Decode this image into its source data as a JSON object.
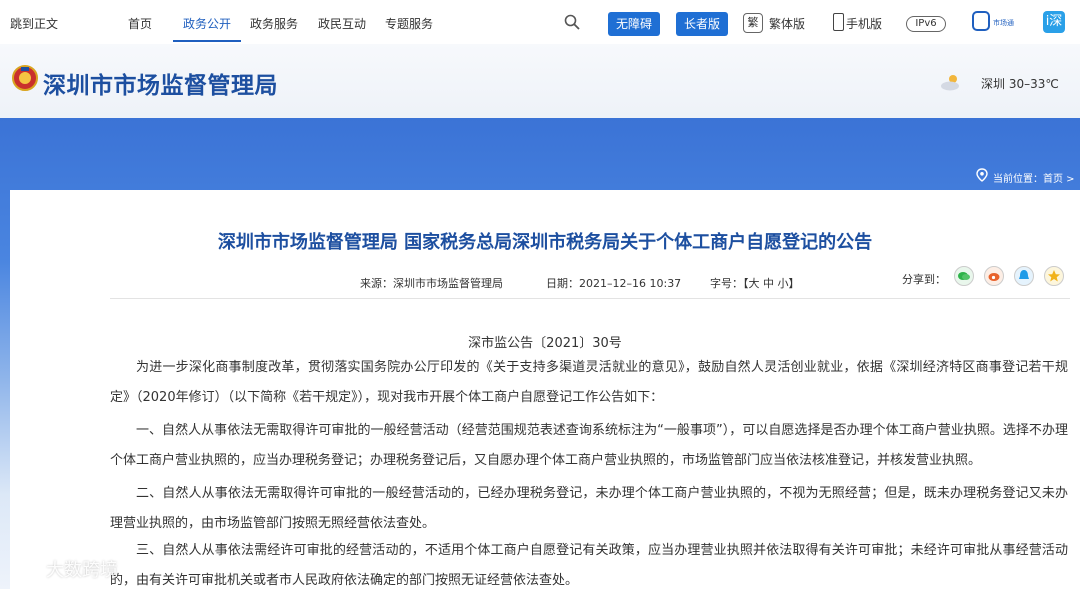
{
  "topnav": {
    "skip": "跳到正文",
    "items": [
      {
        "label": "首页"
      },
      {
        "label": "政务公开"
      },
      {
        "label": "政务服务"
      },
      {
        "label": "政民互动"
      },
      {
        "label": "专题服务"
      }
    ],
    "accessible_btn": "无障碍",
    "elder_btn": "长者版",
    "trad_char": "繁",
    "traditional": "繁体版",
    "mobile": "手机版",
    "ipv6": "IPv6",
    "shichang_label": "市场通",
    "app_char": "i深"
  },
  "header": {
    "title": "深圳市市场监督管理局",
    "weather": "深圳 30–33℃"
  },
  "breadcrumb": {
    "label": "当前位置：",
    "home": "首页 >"
  },
  "article": {
    "title": "深圳市市场监督管理局 国家税务总局深圳市税务局关于个体工商户自愿登记的公告",
    "source": "来源：深圳市市场监督管理局",
    "date": "日期：2021–12–16 10:37",
    "font_size": "字号：【大  中  小】",
    "share_label": "分享到：",
    "doc_no": "深市监公告〔2021〕30号",
    "paragraphs": [
      "为进一步深化商事制度改革，贯彻落实国务院办公厅印发的《关于支持多渠道灵活就业的意见》，鼓励自然人灵活创业就业，依据《深圳经济特区商事登记若干规定》（2020年修订）（以下简称《若干规定》），现对我市开展个体工商户自愿登记工作公告如下：",
      "一、自然人从事依法无需取得许可审批的一般经营活动（经营范围规范表述查询系统标注为“一般事项”），可以自愿选择是否办理个体工商户营业执照。选择不办理个体工商户营业执照的，应当办理税务登记；办理税务登记后，又自愿办理个体工商户营业执照的，市场监管部门应当依法核准登记，并核发营业执照。",
      "二、自然人从事依法无需取得许可审批的一般经营活动的，已经办理税务登记，未办理个体工商户营业执照的，不视为无照经营；但是，既未办理税务登记又未办理营业执照的，由市场监管部门按照无照经营依法查处。",
      "三、自然人从事依法需经许可审批的经营活动的，不适用个体工商户自愿登记有关政策，应当办理营业执照并依法取得有关许可审批；未经许可审批从事经营活动的，由有关许可审批机关或者市人民政府依法确定的部门按照无证经营依法查处。"
    ]
  },
  "watermark": "大数跨境",
  "colors": {
    "brand": "#1d4fa0",
    "button": "#1f6fd4",
    "banner_top": "#3b73d6"
  }
}
